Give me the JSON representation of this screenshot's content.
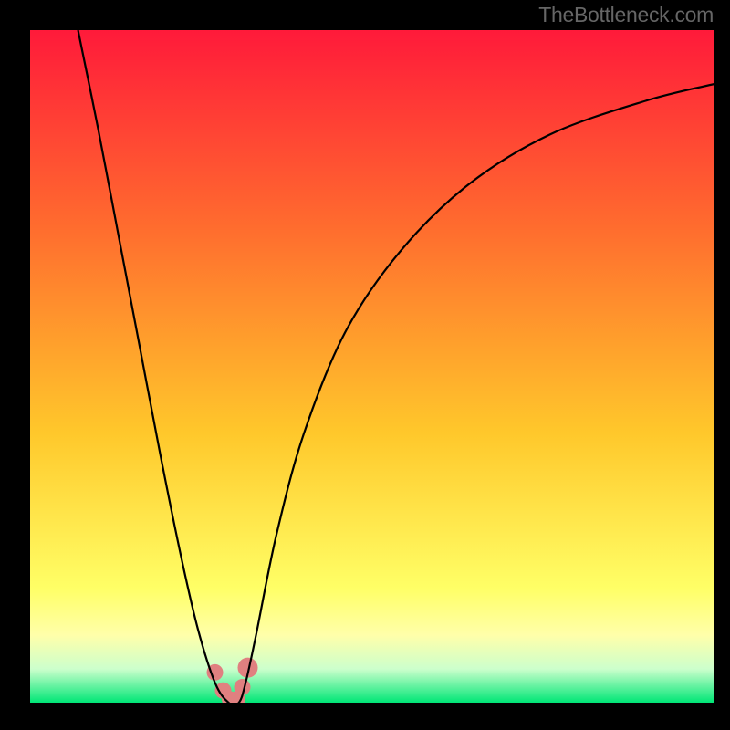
{
  "watermark": "TheBottleneck.com",
  "colors": {
    "bg": "#000000",
    "gradient_top": "#ff1a3a",
    "gradient_30": "#ff6e2e",
    "gradient_60": "#ffc82b",
    "gradient_85": "#ffff66",
    "gradient_90": "#ffffaa",
    "gradient_95": "#ccffcc",
    "gradient_bottom": "#00e676",
    "curve": "#000000",
    "marker_fill": "#e08080",
    "marker_stroke": "#c86060"
  },
  "chart_data": {
    "type": "line",
    "title": "",
    "xlabel": "",
    "ylabel": "",
    "xlim": [
      0,
      100
    ],
    "ylim": [
      0,
      100
    ],
    "series": [
      {
        "name": "bottleneck-curve",
        "x": [
          7,
          10,
          13,
          16,
          19,
          22,
          24.5,
          27,
          29,
          30.5,
          31.5,
          33,
          36,
          40,
          46,
          54,
          64,
          76,
          90,
          100
        ],
        "y": [
          100,
          85,
          69,
          53,
          37,
          22,
          11,
          3,
          0,
          0,
          3,
          10,
          25,
          40,
          55,
          67,
          77,
          84.5,
          89.5,
          92
        ]
      }
    ],
    "markers": {
      "name": "highlight-points",
      "x": [
        27,
        28.2,
        29.2,
        30.2,
        31,
        31.8
      ],
      "y": [
        4.5,
        1.8,
        0.5,
        0.5,
        2.3,
        5.2
      ],
      "r": [
        9,
        9,
        9,
        9,
        9,
        11
      ]
    }
  }
}
